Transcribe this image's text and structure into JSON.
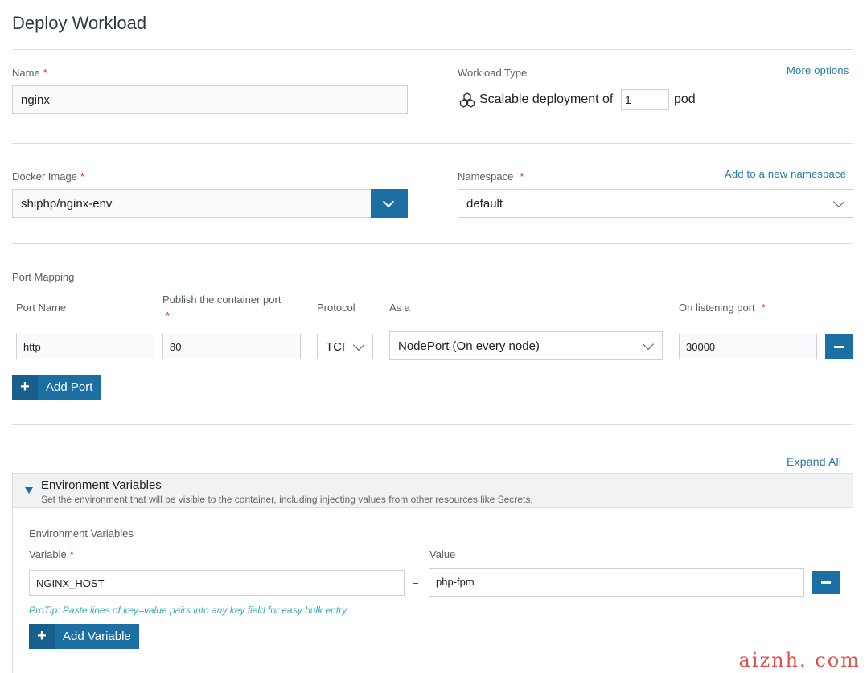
{
  "page": {
    "title": "Deploy Workload"
  },
  "name": {
    "label": "Name",
    "required_mark": "*",
    "value": "nginx"
  },
  "workload_type": {
    "label": "Workload Type",
    "more_options": "More options",
    "prefix": "Scalable deployment of",
    "count": "1",
    "suffix": "pod",
    "icon": "cluster-icon"
  },
  "docker_image": {
    "label": "Docker Image",
    "required_mark": "*",
    "value": "shiphp/nginx-env"
  },
  "namespace": {
    "label": "Namespace",
    "required_mark": "*",
    "value": "default",
    "add_link": "Add to a new namespace"
  },
  "port_mapping": {
    "section_label": "Port Mapping",
    "col_port_name": "Port Name",
    "col_publish": "Publish the container port",
    "col_publish_req": "*",
    "col_protocol": "Protocol",
    "col_as_a": "As a",
    "col_listening": "On listening port",
    "col_listening_req": "*",
    "row": {
      "port_name": "http",
      "container_port": "80",
      "protocol": "TCP",
      "as_a": "NodePort (On every node)",
      "listening_port": "30000"
    },
    "add_port": "Add Port"
  },
  "env": {
    "expand_all": "Expand All",
    "panel_title": "Environment Variables",
    "panel_desc": "Set the environment that will be visible to the container, including injecting values from other resources like Secrets.",
    "sub_label": "Environment Variables",
    "variable_label": "Variable",
    "variable_req": "*",
    "value_label": "Value",
    "row": {
      "key": "NGINX_HOST",
      "equals": "=",
      "value": "php-fpm"
    },
    "protip": "ProTip: Paste lines of key=value pairs into any key field for easy bulk entry.",
    "add_variable": "Add Variable"
  },
  "watermark": "aiznh. com",
  "colors": {
    "accent": "#1c6fa3",
    "link": "#2479a8",
    "required": "#d2311f",
    "protip": "#3aa8c1"
  }
}
